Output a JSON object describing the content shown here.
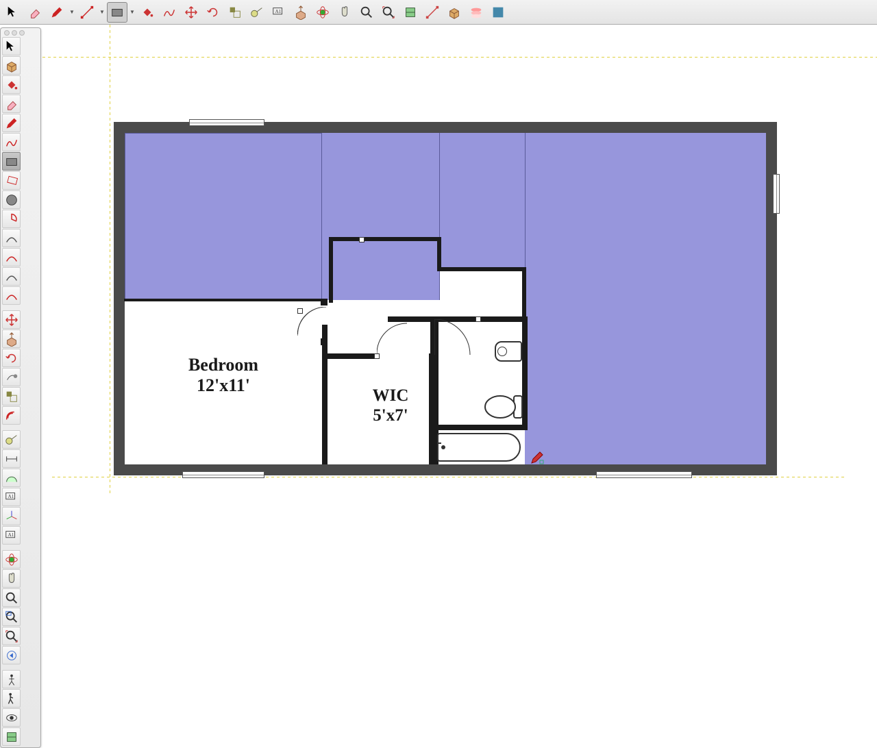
{
  "top_tools": [
    {
      "name": "select-arrow-icon",
      "color": "#000"
    },
    {
      "name": "eraser-icon",
      "color": "#e88"
    },
    {
      "name": "pencil-red-icon",
      "color": "#c22",
      "dd": true
    },
    {
      "name": "line-icon",
      "color": "#c22",
      "dd": true
    },
    {
      "name": "rectangle-icon",
      "color": "#666",
      "active": true,
      "dd": true
    },
    {
      "name": "paint-bucket-icon",
      "color": "#c33"
    },
    {
      "name": "freehand-icon",
      "color": "#c33"
    },
    {
      "name": "move-icon",
      "color": "#c33"
    },
    {
      "name": "rotate-icon",
      "color": "#c33"
    },
    {
      "name": "scale-icon",
      "color": "#884"
    },
    {
      "name": "tape-measure-icon",
      "color": "#886"
    },
    {
      "name": "text-icon",
      "color": "#444"
    },
    {
      "name": "push-pull-icon",
      "color": "#a83"
    },
    {
      "name": "orbit-icon",
      "color": "#3a3"
    },
    {
      "name": "pan-icon",
      "color": "#555"
    },
    {
      "name": "zoom-icon",
      "color": "#333"
    },
    {
      "name": "zoom-extents-icon",
      "color": "#c33"
    },
    {
      "name": "section-plane-icon",
      "color": "#6a6"
    },
    {
      "name": "outliner-icon",
      "color": "#c44"
    },
    {
      "name": "component-icon",
      "color": "#ca4"
    },
    {
      "name": "layers-icon",
      "color": "#d88"
    },
    {
      "name": "preferences-icon",
      "color": "#48a"
    }
  ],
  "left_tools": [
    {
      "name": "select-icon"
    },
    {
      "name": "component-box-icon"
    },
    {
      "name": "paint-icon"
    },
    {
      "name": "eraser2-icon"
    },
    {
      "name": "pencil-icon",
      "color": "#c22"
    },
    {
      "name": "freehand2-icon",
      "color": "#c22"
    },
    {
      "name": "rect-icon",
      "active": true
    },
    {
      "name": "rot-rect-icon",
      "color": "#c22"
    },
    {
      "name": "circle-icon"
    },
    {
      "name": "pie-icon",
      "color": "#c22"
    },
    {
      "name": "arc1-icon"
    },
    {
      "name": "arc2-icon",
      "color": "#c22"
    },
    {
      "name": "arc3-icon"
    },
    {
      "name": "arc4-icon",
      "color": "#c22"
    },
    "divider",
    {
      "name": "move2-icon",
      "color": "#c33"
    },
    {
      "name": "pushpull2-icon"
    },
    {
      "name": "rotate2-icon",
      "color": "#c33"
    },
    {
      "name": "followme-icon"
    },
    {
      "name": "scale2-icon",
      "color": "#c33"
    },
    {
      "name": "offset-icon",
      "color": "#c22"
    },
    "divider",
    {
      "name": "tape-icon"
    },
    {
      "name": "dim-icon"
    },
    {
      "name": "protractor-icon"
    },
    {
      "name": "text2-icon"
    },
    {
      "name": "axes-icon"
    },
    {
      "name": "3dtext-icon"
    },
    "divider",
    {
      "name": "orbit2-icon",
      "color": "#3a3"
    },
    {
      "name": "pan2-icon"
    },
    {
      "name": "zoom2-icon"
    },
    {
      "name": "zoomwin-icon"
    },
    {
      "name": "zoomext-icon"
    },
    {
      "name": "prev-icon"
    },
    "divider",
    {
      "name": "position-camera-icon"
    },
    {
      "name": "walk-icon"
    },
    {
      "name": "look-around-icon"
    },
    {
      "name": "section-icon"
    }
  ],
  "rooms": {
    "bedroom": {
      "label": "Bedroom",
      "dim": "12'x11'"
    },
    "wic": {
      "label": "WIC",
      "dim": "5'x7'"
    }
  },
  "canvas": {
    "fill_color": "#9796dc",
    "wall_color": "#4a4a4a"
  }
}
